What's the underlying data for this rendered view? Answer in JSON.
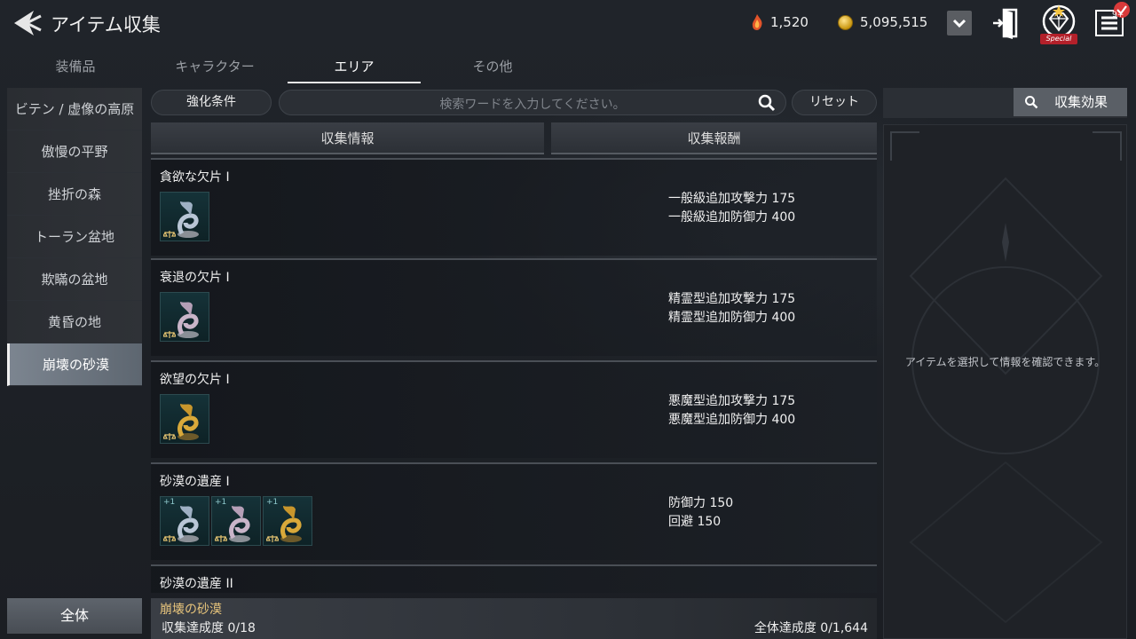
{
  "header": {
    "title": "アイテム収集",
    "currency1": "1,520",
    "currency2": "5,095,515",
    "special_label": "Special",
    "menu_badge": "9+"
  },
  "tabs": [
    "装備品",
    "キャラクター",
    "エリア",
    "その他"
  ],
  "active_tab": "エリア",
  "sidebar": {
    "items": [
      "ビテン / 虚像の高原",
      "傲慢の平野",
      "挫折の森",
      "トーラン盆地",
      "欺瞞の盆地",
      "黄昏の地",
      "崩壊の砂漠"
    ],
    "active": "崩壊の砂漠",
    "all_label": "全体"
  },
  "toolbar": {
    "condition_label": "強化条件",
    "search_placeholder": "検索ワードを入力してください。",
    "reset_label": "リセット"
  },
  "columns": {
    "info": "収集情報",
    "reward": "収集報酬"
  },
  "rows": [
    {
      "name": "貪欲な欠片 Ⅰ",
      "rewards": [
        "一般級追加攻撃力 175",
        "一般級追加防御力 400"
      ]
    },
    {
      "name": "衰退の欠片 Ⅰ",
      "rewards": [
        "精霊型追加攻撃力 175",
        "精霊型追加防御力 400"
      ]
    },
    {
      "name": "欲望の欠片 Ⅰ",
      "rewards": [
        "悪魔型追加攻撃力 175",
        "悪魔型追加防御力 400"
      ]
    },
    {
      "name": "砂漠の遺産 Ⅰ",
      "rewards": [
        "防御力 150",
        "回避 150"
      ]
    },
    {
      "name": "砂漠の遺産 II",
      "rewards": []
    }
  ],
  "item_plus_label": "+1",
  "footer": {
    "area": "崩壊の砂漠",
    "progress": "収集達成度 0/18",
    "total": "全体達成度 0/1,644"
  },
  "right_panel": {
    "effect_label": "収集効果",
    "message": "アイテムを選択して情報を確認できます。"
  },
  "colors": {
    "accent": "#e8c57c",
    "badge": "#d93a3a",
    "item_bg": "#153238"
  }
}
